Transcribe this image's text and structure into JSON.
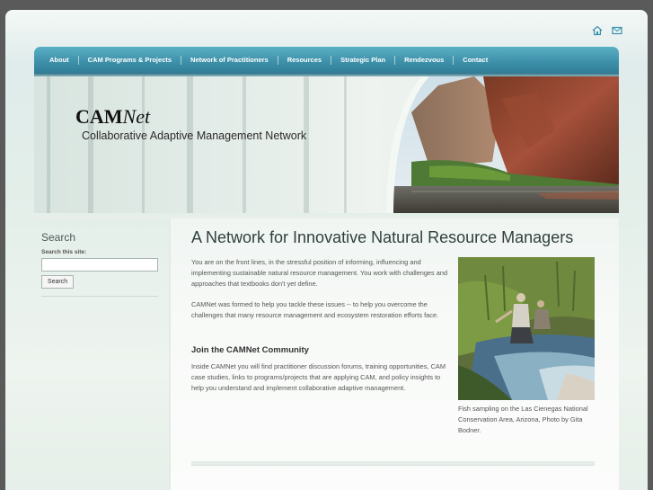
{
  "nav": [
    "About",
    "CAM Programs & Projects",
    "Network of Practitioners",
    "Resources",
    "Strategic Plan",
    "Rendezvous",
    "Contact"
  ],
  "icons": {
    "home": "home-icon",
    "mail": "mail-icon"
  },
  "banner": {
    "logo_bold": "CAM",
    "logo_italic": "Net",
    "tagline": "Collaborative Adaptive Management Network"
  },
  "sidebar": {
    "title": "Search",
    "label": "Search this site:",
    "input_value": "",
    "button": "Search"
  },
  "main": {
    "title": "A Network for Innovative Natural Resource Managers",
    "para1": "You are on the front lines, in the stressful position of informing, influencing and implementing sustainable natural resource management. You work with challenges and approaches that textbooks don't yet define.",
    "para2": "CAMNet was formed to help you tackle these issues -- to help you overcome the challenges that  many resource management and ecosystem restoration efforts face.",
    "join_heading": "Join the CAMNet Community",
    "para3": "Inside CAMNet you will find practitioner discussion forums, training opportunities, CAM case studies, links to programs/projects that are applying CAM, and policy insights to help you understand and implement collaborative adaptive management.",
    "caption": "Fish sampling on the Las Cienegas National Conservation Area, Arizona, Photo by Gita Bodner."
  },
  "colors": {
    "nav_bar": "#3f92ab",
    "page_bg": "#e3eee9",
    "heading": "#2f3f3f"
  }
}
